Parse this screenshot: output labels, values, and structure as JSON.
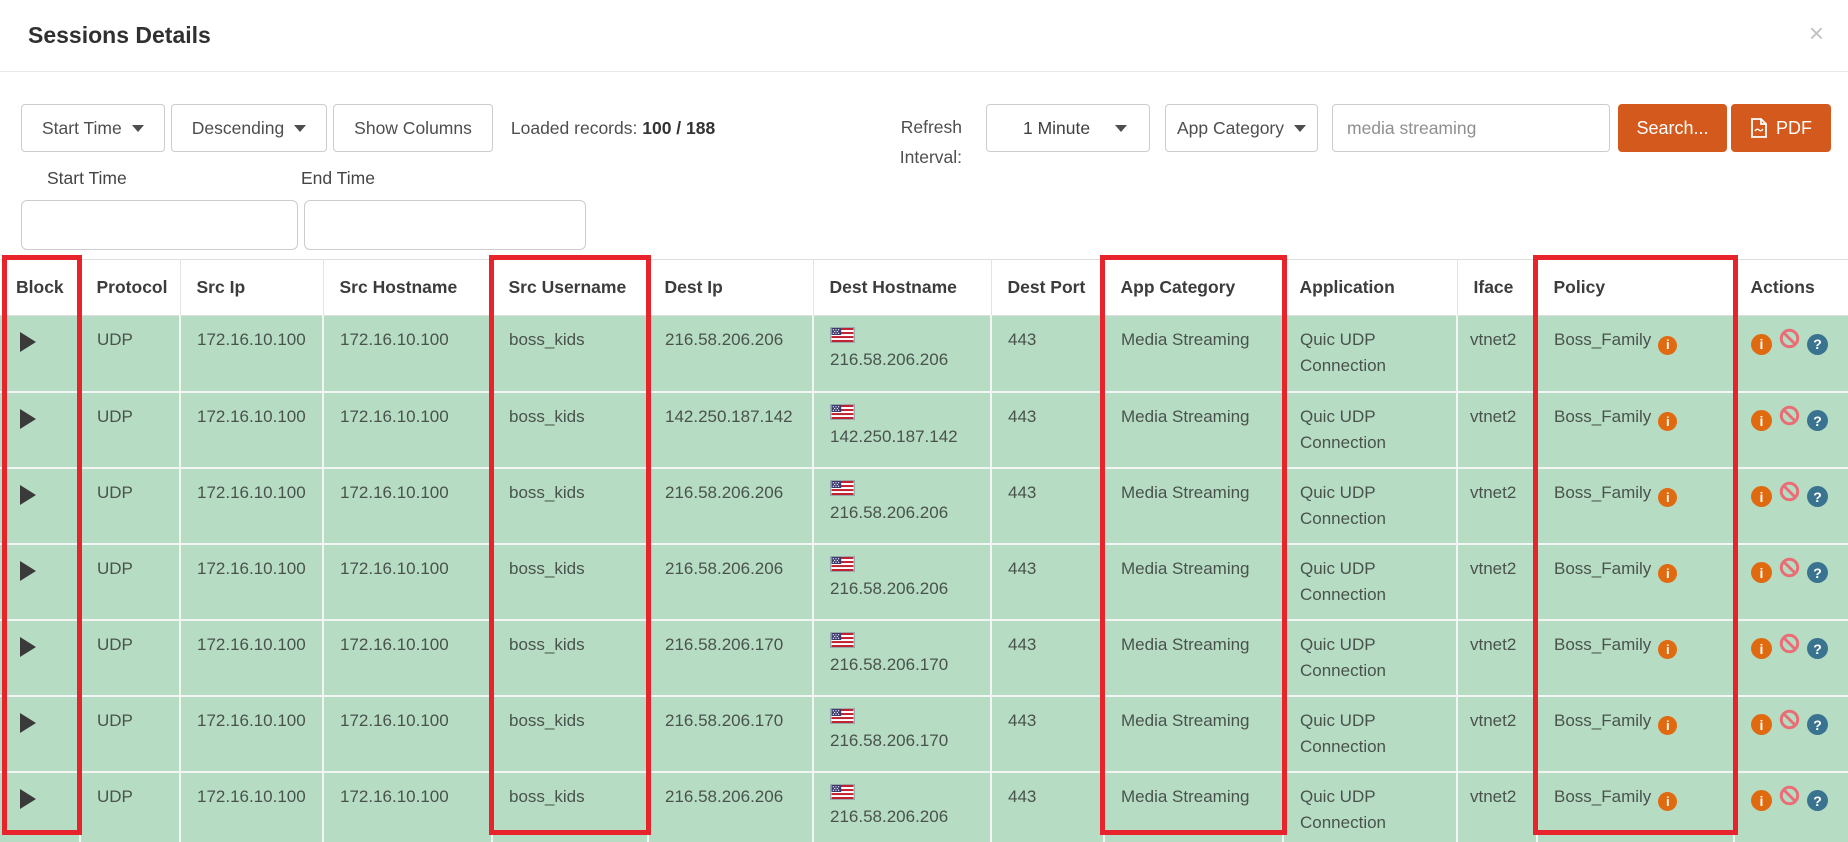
{
  "modal": {
    "title": "Sessions Details",
    "close_glyph": "×"
  },
  "toolbar": {
    "sort_field_button": "Start Time",
    "sort_order_button": "Descending",
    "show_columns_button": "Show Columns",
    "loaded_records_label": "Loaded records:",
    "loaded_records_value": "100 / 188",
    "refresh_label_line1": "Refresh",
    "refresh_label_line2": "Interval:",
    "refresh_interval_value": "1 Minute",
    "filter_field_button": "App Category",
    "search_value": "media streaming",
    "search_button": "Search...",
    "pdf_button": "PDF"
  },
  "time_filters": {
    "start_label": "Start Time",
    "end_label": "End Time",
    "start_value": "",
    "end_value": ""
  },
  "table": {
    "columns": [
      "Block",
      "Protocol",
      "Src Ip",
      "Src Hostname",
      "Src Username",
      "Dest Ip",
      "Dest Hostname",
      "Dest Port",
      "App Category",
      "Application",
      "Iface",
      "Policy",
      "Actions"
    ],
    "highlighted_columns": [
      "Block",
      "Src Username",
      "App Category",
      "Policy"
    ],
    "action_icons": {
      "info_glyph": "i",
      "help_glyph": "?"
    },
    "rows": [
      {
        "protocol": "UDP",
        "src_ip": "172.16.10.100",
        "src_hostname": "172.16.10.100",
        "src_username": "boss_kids",
        "dest_ip": "216.58.206.206",
        "dest_hostname": "216.58.206.206",
        "dest_country": "US",
        "dest_port": "443",
        "app_category": "Media Streaming",
        "application": "Quic UDP Connection",
        "iface": "vtnet2",
        "policy": "Boss_Family"
      },
      {
        "protocol": "UDP",
        "src_ip": "172.16.10.100",
        "src_hostname": "172.16.10.100",
        "src_username": "boss_kids",
        "dest_ip": "142.250.187.142",
        "dest_hostname": "142.250.187.142",
        "dest_country": "US",
        "dest_port": "443",
        "app_category": "Media Streaming",
        "application": "Quic UDP Connection",
        "iface": "vtnet2",
        "policy": "Boss_Family"
      },
      {
        "protocol": "UDP",
        "src_ip": "172.16.10.100",
        "src_hostname": "172.16.10.100",
        "src_username": "boss_kids",
        "dest_ip": "216.58.206.206",
        "dest_hostname": "216.58.206.206",
        "dest_country": "US",
        "dest_port": "443",
        "app_category": "Media Streaming",
        "application": "Quic UDP Connection",
        "iface": "vtnet2",
        "policy": "Boss_Family"
      },
      {
        "protocol": "UDP",
        "src_ip": "172.16.10.100",
        "src_hostname": "172.16.10.100",
        "src_username": "boss_kids",
        "dest_ip": "216.58.206.206",
        "dest_hostname": "216.58.206.206",
        "dest_country": "US",
        "dest_port": "443",
        "app_category": "Media Streaming",
        "application": "Quic UDP Connection",
        "iface": "vtnet2",
        "policy": "Boss_Family"
      },
      {
        "protocol": "UDP",
        "src_ip": "172.16.10.100",
        "src_hostname": "172.16.10.100",
        "src_username": "boss_kids",
        "dest_ip": "216.58.206.170",
        "dest_hostname": "216.58.206.170",
        "dest_country": "US",
        "dest_port": "443",
        "app_category": "Media Streaming",
        "application": "Quic UDP Connection",
        "iface": "vtnet2",
        "policy": "Boss_Family"
      },
      {
        "protocol": "UDP",
        "src_ip": "172.16.10.100",
        "src_hostname": "172.16.10.100",
        "src_username": "boss_kids",
        "dest_ip": "216.58.206.170",
        "dest_hostname": "216.58.206.170",
        "dest_country": "US",
        "dest_port": "443",
        "app_category": "Media Streaming",
        "application": "Quic UDP Connection",
        "iface": "vtnet2",
        "policy": "Boss_Family"
      },
      {
        "protocol": "UDP",
        "src_ip": "172.16.10.100",
        "src_hostname": "172.16.10.100",
        "src_username": "boss_kids",
        "dest_ip": "216.58.206.206",
        "dest_hostname": "216.58.206.206",
        "dest_country": "US",
        "dest_port": "443",
        "app_category": "Media Streaming",
        "application": "Quic UDP Connection",
        "iface": "vtnet2",
        "policy": "Boss_Family"
      }
    ]
  },
  "colors": {
    "accent_orange": "#d4591d",
    "row_green": "#b6ddc4",
    "highlight_red": "#e7242b",
    "info_icon_orange": "#e06a10",
    "ban_icon_pink": "#ea6d75",
    "help_icon_blue": "#3a7390"
  }
}
